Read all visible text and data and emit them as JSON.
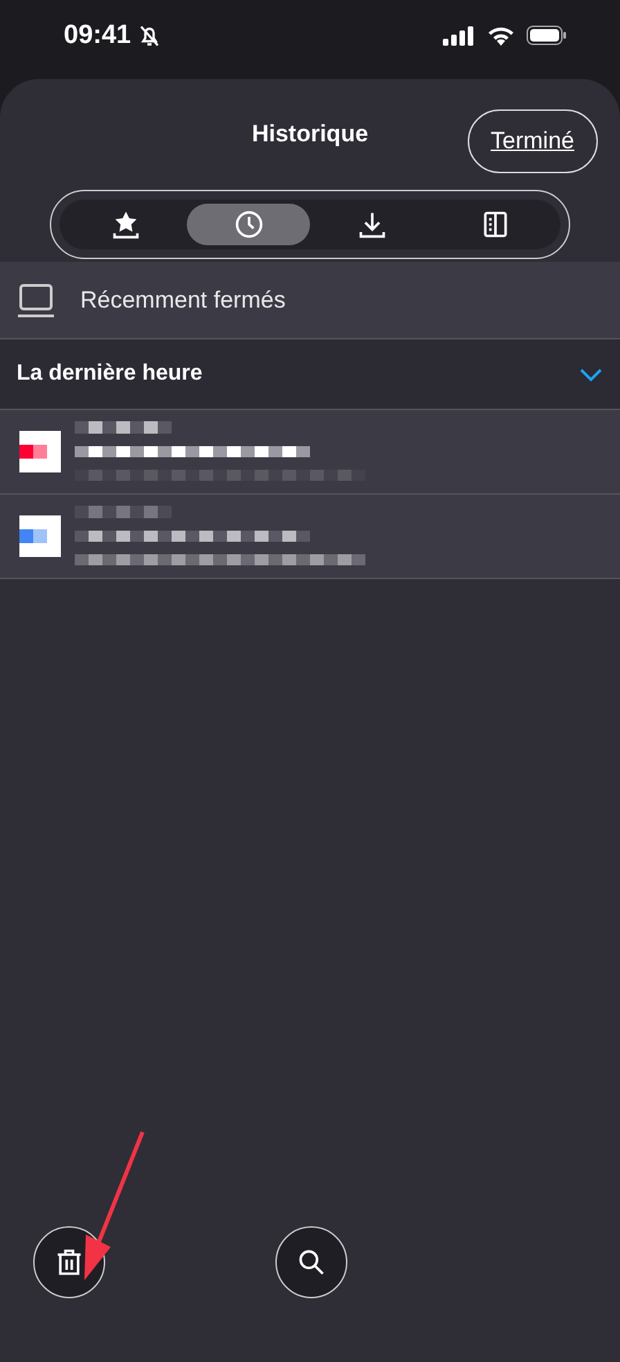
{
  "status_bar": {
    "time": "09:41",
    "silent": true
  },
  "sheet": {
    "title": "Historique",
    "done_button": "Terminé"
  },
  "tabs": [
    {
      "kind": "bookmarks",
      "selected": false
    },
    {
      "kind": "history",
      "selected": true
    },
    {
      "kind": "downloads",
      "selected": false
    },
    {
      "kind": "reading_list",
      "selected": false
    }
  ],
  "recently_closed": {
    "label": "Récemment fermés"
  },
  "section": {
    "title": "La dernière heure",
    "expanded": true
  },
  "history_items": [
    {
      "color": "#ff0033"
    },
    {
      "color": "#4285f4"
    }
  ],
  "bottom_bar": {
    "buttons": [
      {
        "kind": "trash"
      },
      {
        "kind": "search"
      }
    ]
  },
  "annotation": {
    "kind": "arrow",
    "color": "#f23345"
  }
}
